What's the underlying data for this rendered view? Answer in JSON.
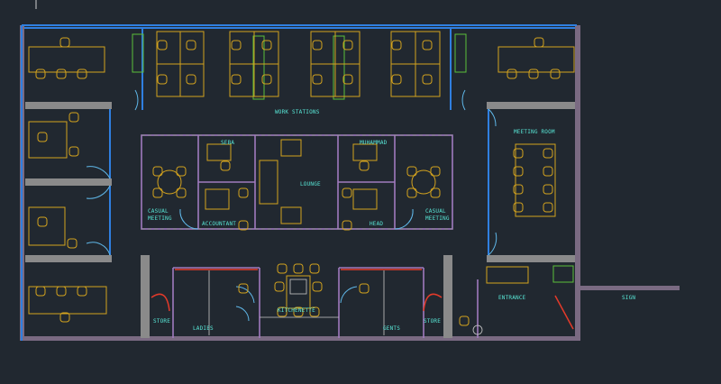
{
  "labels": {
    "work_stations": "WORK STATIONS",
    "meeting_room": "MEETING ROOM",
    "seba": "SEBA",
    "muhammad": "MUHAMMAD",
    "lounge": "LOUNGE",
    "casual_meeting": "CASUAL",
    "casual_meeting_2": "MEETING",
    "accountant": "ACCOUNTANT",
    "head": "HEAD",
    "entrance": "ENTRANCE",
    "sign": "SIGN",
    "store": "STORE",
    "ladies": "LADIES",
    "kitchenette": "KITCHENETTE",
    "gents": "GENTS"
  },
  "colors": {
    "background": "#212830",
    "label": "#58e6d6",
    "furniture": "#d4a31e",
    "glass_partition": "#2f7fe0",
    "wall": "#7a6a82",
    "planter": "#5cbf3a",
    "door_swing": "#5fb7e8"
  }
}
